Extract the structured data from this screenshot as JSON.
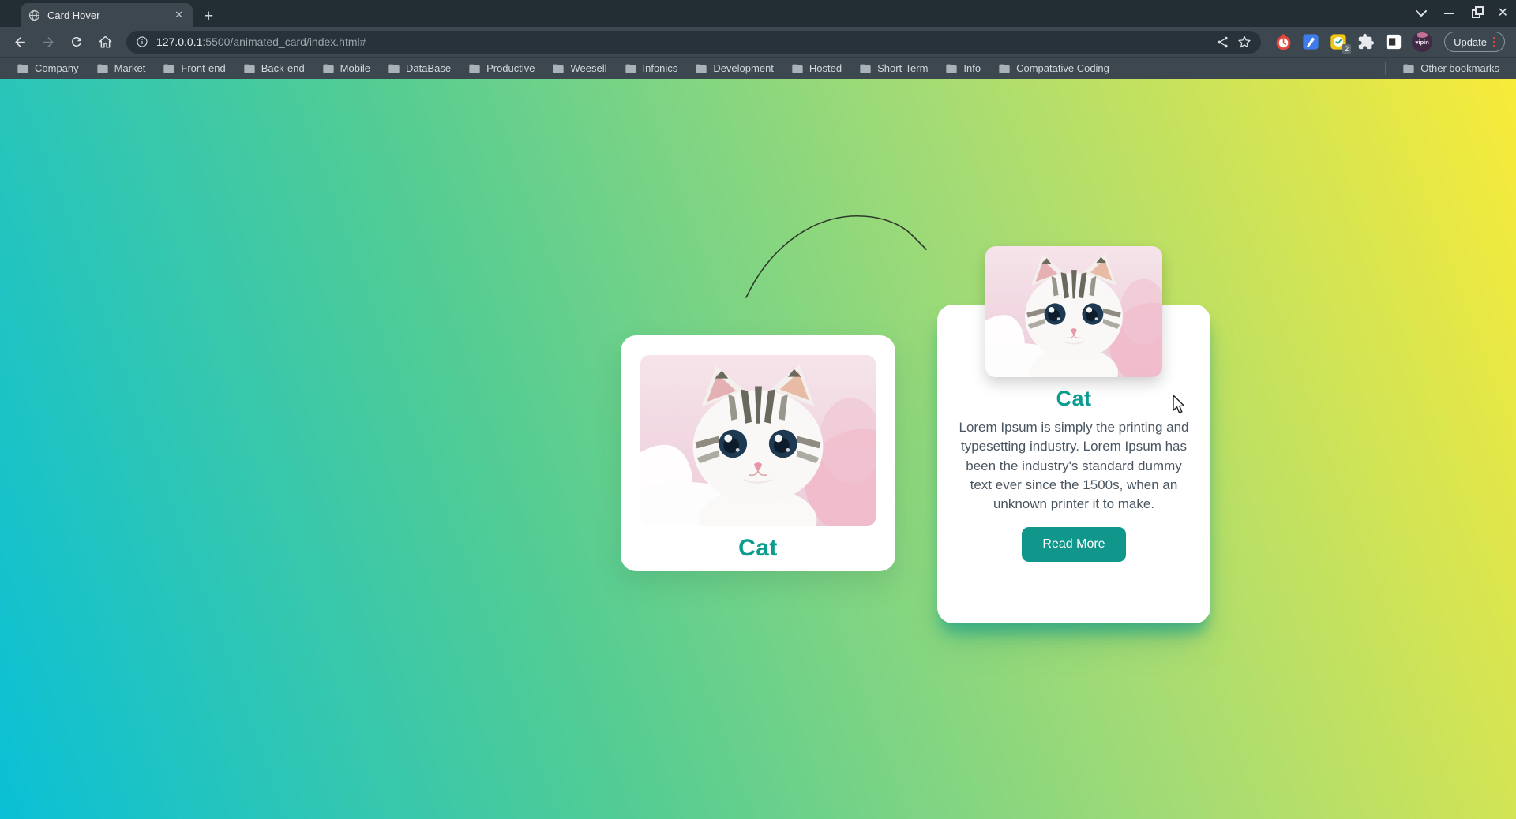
{
  "browser": {
    "tab": {
      "title": "Card Hover"
    },
    "icons": {
      "tab_close": "✕",
      "new_tab": "+",
      "window_close": "✕"
    },
    "url": {
      "host": "127.0.0.1",
      "rest": ":5500/animated_card/index.html#"
    },
    "toolbar": {
      "update_label": "Update",
      "avatar_label": "vipin",
      "extension_badge_count": "2"
    },
    "bookmarks": [
      "Company",
      "Market",
      "Front-end",
      "Back-end",
      "Mobile",
      "DataBase",
      "Productive",
      "Weesell",
      "Infonics",
      "Development",
      "Hosted",
      "Short-Term",
      "Info",
      "Compatative Coding"
    ],
    "other_bookmarks_label": "Other bookmarks"
  },
  "page": {
    "colors": {
      "accent_title_teal": "#0b9c90",
      "button_teal": "#10968a",
      "bg_gradient_stops": [
        "#0ac0d6",
        "#52cc94",
        "#a8dc73",
        "#f8eb39"
      ],
      "card_bg": "#ffffff",
      "description_gray": "#4a5560"
    },
    "card_left": {
      "title": "Cat"
    },
    "card_right": {
      "title": "Cat",
      "description": "Lorem Ipsum is simply the printing and typesetting industry. Lorem Ipsum has been the industry's standard dummy text ever since the 1500s, when an unknown printer it to make.",
      "button_label": "Read More"
    }
  }
}
